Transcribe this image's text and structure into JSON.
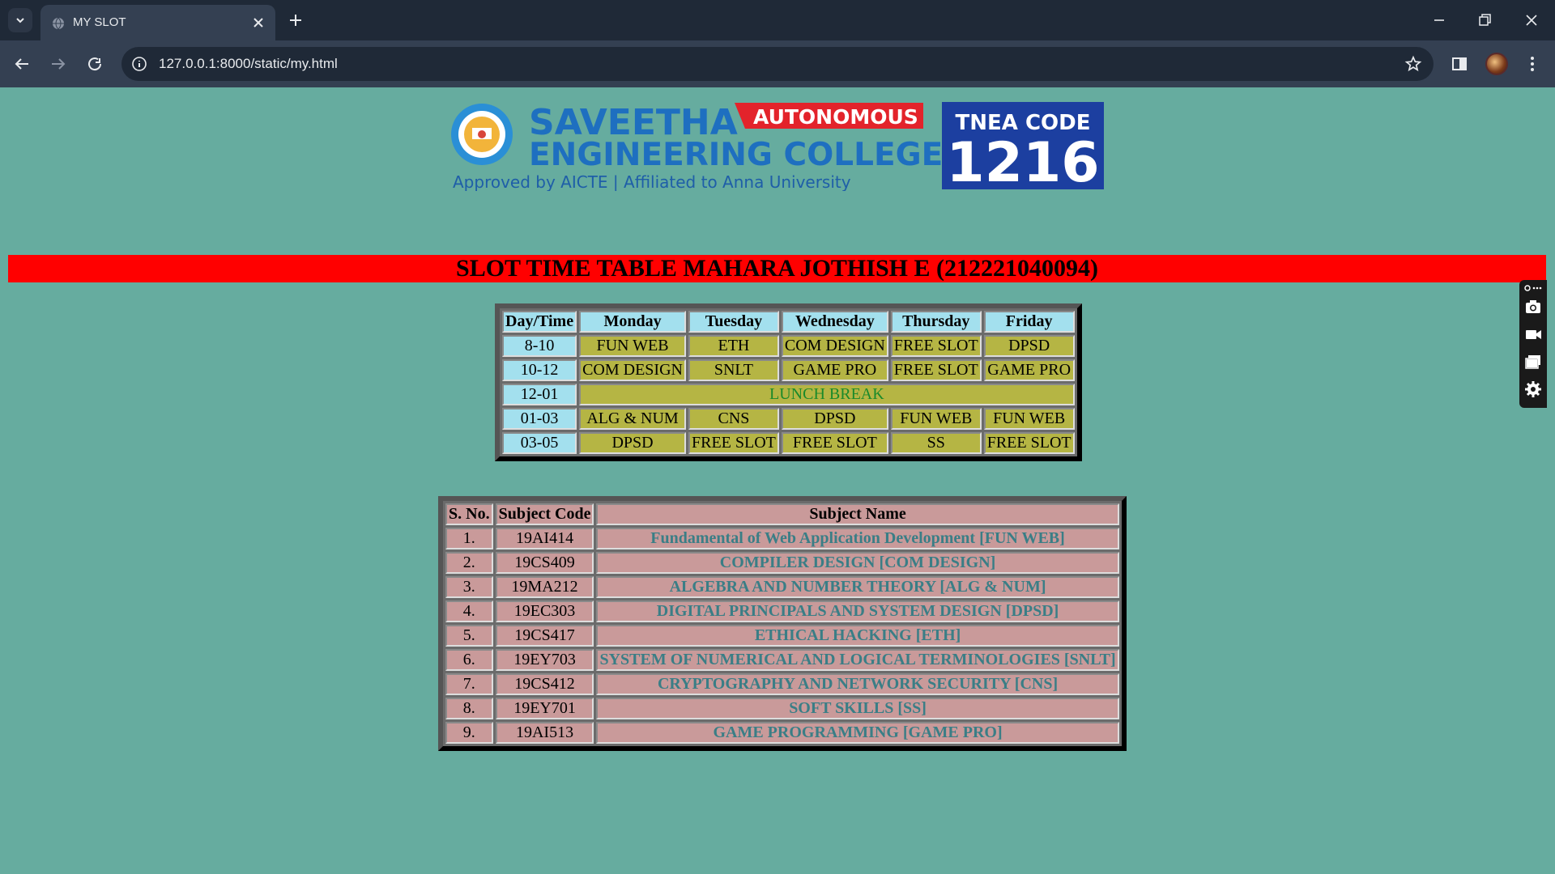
{
  "browser": {
    "tab_title": "MY SLOT",
    "url": "127.0.0.1:8000/static/my.html"
  },
  "logo": {
    "line1": "SAVEETHA",
    "badge": "AUTONOMOUS",
    "line2": "ENGINEERING COLLEGE",
    "tagline": "Approved by AICTE  |  Affiliated to Anna University",
    "code_label": "TNEA CODE",
    "code": "1216"
  },
  "title": "SLOT TIME TABLE MAHARA JOTHISH E (212221040094)",
  "timetable": {
    "headers": [
      "Day/Time",
      "Monday",
      "Tuesday",
      "Wednesday",
      "Thursday",
      "Friday"
    ],
    "rows": [
      {
        "time": "8-10",
        "cells": [
          "FUN WEB",
          "ETH",
          "COM DESIGN",
          "FREE SLOT",
          "DPSD"
        ]
      },
      {
        "time": "10-12",
        "cells": [
          "COM DESIGN",
          "SNLT",
          "GAME PRO",
          "FREE SLOT",
          "GAME PRO"
        ]
      },
      {
        "time": "12-01",
        "lunch": "LUNCH BREAK"
      },
      {
        "time": "01-03",
        "cells": [
          "ALG & NUM",
          "CNS",
          "DPSD",
          "FUN WEB",
          "FUN WEB"
        ]
      },
      {
        "time": "03-05",
        "cells": [
          "DPSD",
          "FREE SLOT",
          "FREE SLOT",
          "SS",
          "FREE SLOT"
        ]
      }
    ]
  },
  "subjects": {
    "headers": [
      "S. No.",
      "Subject Code",
      "Subject Name"
    ],
    "rows": [
      {
        "no": "1.",
        "code": "19AI414",
        "name": "Fundamental of Web Application Development [FUN WEB]"
      },
      {
        "no": "2.",
        "code": "19CS409",
        "name": "COMPILER DESIGN [COM DESIGN]"
      },
      {
        "no": "3.",
        "code": "19MA212",
        "name": "ALGEBRA AND NUMBER THEORY [ALG & NUM]"
      },
      {
        "no": "4.",
        "code": "19EC303",
        "name": "DIGITAL PRINCIPALS AND SYSTEM DESIGN [DPSD]"
      },
      {
        "no": "5.",
        "code": "19CS417",
        "name": "ETHICAL HACKING [ETH]"
      },
      {
        "no": "6.",
        "code": "19EY703",
        "name": "SYSTEM OF NUMERICAL AND LOGICAL TERMINOLOGIES [SNLT]"
      },
      {
        "no": "7.",
        "code": "19CS412",
        "name": "CRYPTOGRAPHY AND NETWORK SECURITY [CNS]"
      },
      {
        "no": "8.",
        "code": "19EY701",
        "name": "SOFT SKILLS [SS]"
      },
      {
        "no": "9.",
        "code": "19AI513",
        "name": "GAME PROGRAMMING [GAME PRO]"
      }
    ]
  },
  "colors": {
    "page_bg": "#66ac9f",
    "title_bg": "#ff0000",
    "header_cell": "#a3e0ee",
    "slot_cell": "#b5b544",
    "subject_cell": "#c99a9a",
    "subject_name_text": "#3a7e86",
    "lunch_text": "#1a8a2a"
  }
}
